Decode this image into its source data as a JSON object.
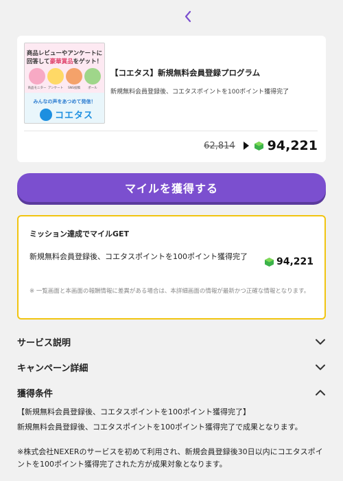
{
  "nav": {
    "back_icon": "chevron-left-icon",
    "accent": "#7b4fcf"
  },
  "offer": {
    "banner": {
      "line1": "商品レビューやアンケートに",
      "line2_prefix": "回答して",
      "line2_highlight": "豪華賞品",
      "line2_suffix": "をゲット！",
      "captions": [
        "商品モニター",
        "アンケート",
        "SNS投稿",
        "ポール"
      ],
      "subline": "みんなの声をあつめて発信！",
      "logo_text": "コエタス"
    },
    "title": "【コエタス】新規無料会員登録プログラム",
    "description": "新規無料会員登録後、コエタスポイントを100ポイント獲得完了",
    "old_points": "62,814",
    "new_points": "94,221",
    "gem_color": "#3cb24a"
  },
  "cta": {
    "label": "マイルを獲得する"
  },
  "mission": {
    "title": "ミッション達成でマイルGET",
    "description": "新規無料会員登録後、コエタスポイントを100ポイント獲得完了",
    "points": "94,221",
    "note": "※ 一覧画面と本画面の報酬情報に差異がある場合は、本詳細画面の情報が最新かつ正確な情報となります。",
    "border_color": "#f1c40f"
  },
  "sections": {
    "service": {
      "title": "サービス説明",
      "state": "collapsed"
    },
    "campaign": {
      "title": "キャンペーン詳細",
      "state": "collapsed"
    },
    "conditions": {
      "title": "獲得条件",
      "state": "expanded",
      "line1": "【新規無料会員登録後、コエタスポイントを100ポイント獲得完了】",
      "line2": "新規無料会員登録後、コエタスポイントを100ポイント獲得完了で成果となります。",
      "line3": "※株式会社NEXERのサービスを初めて利用され、新規会員登録後30日以内にコエタスポイントを100ポイント獲得完了された方が成果対象となります。"
    }
  }
}
